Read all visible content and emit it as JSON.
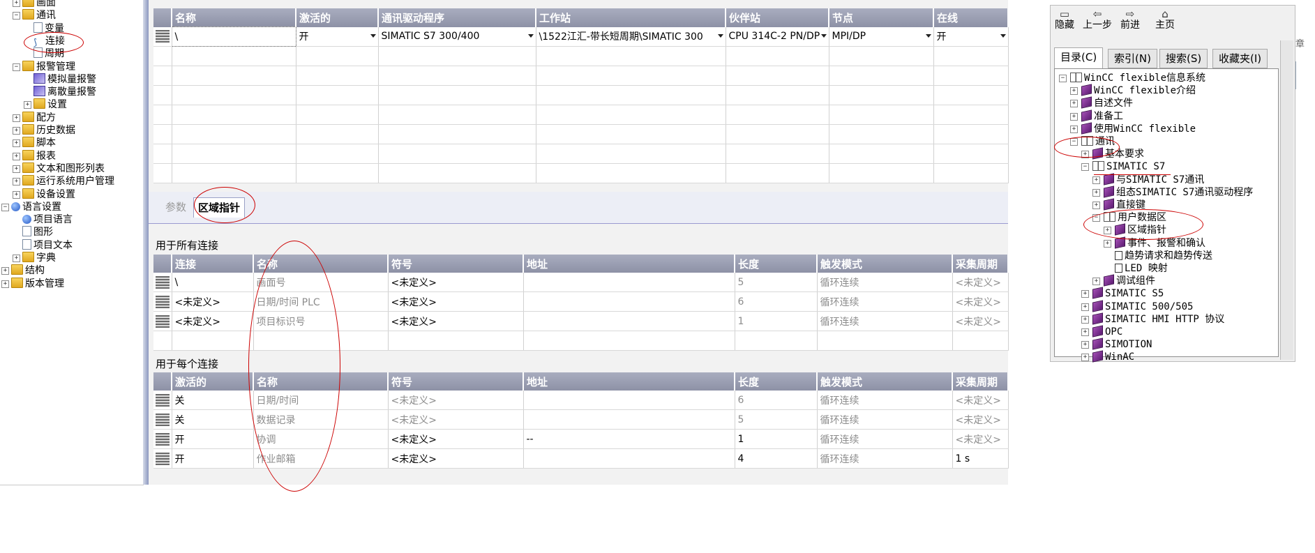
{
  "tree": {
    "items": [
      {
        "label": "画面",
        "level": 1,
        "icon": "folder",
        "toggle": "+"
      },
      {
        "label": "通讯",
        "level": 1,
        "icon": "folder",
        "toggle": "-"
      },
      {
        "label": "变量",
        "level": 2,
        "icon": "doc"
      },
      {
        "label": "连接",
        "level": 2,
        "icon": "conn"
      },
      {
        "label": "周期",
        "level": 2,
        "icon": "doc"
      },
      {
        "label": "报警管理",
        "level": 1,
        "icon": "folder",
        "toggle": "-"
      },
      {
        "label": "模拟量报警",
        "level": 2,
        "icon": "alarm"
      },
      {
        "label": "离散量报警",
        "level": 2,
        "icon": "alarm"
      },
      {
        "label": "设置",
        "level": 2,
        "icon": "folder",
        "toggle": "+"
      },
      {
        "label": "配方",
        "level": 1,
        "icon": "folder",
        "toggle": "+"
      },
      {
        "label": "历史数据",
        "level": 1,
        "icon": "folder",
        "toggle": "+"
      },
      {
        "label": "脚本",
        "level": 1,
        "icon": "folder",
        "toggle": "+"
      },
      {
        "label": "报表",
        "level": 1,
        "icon": "folder",
        "toggle": "+"
      },
      {
        "label": "文本和图形列表",
        "level": 1,
        "icon": "folder",
        "toggle": "+"
      },
      {
        "label": "运行系统用户管理",
        "level": 1,
        "icon": "folder",
        "toggle": "+"
      },
      {
        "label": "设备设置",
        "level": 1,
        "icon": "folder",
        "toggle": "+"
      },
      {
        "label": "语言设置",
        "level": 0,
        "icon": "globe",
        "toggle": "-"
      },
      {
        "label": "项目语言",
        "level": 1,
        "icon": "globe"
      },
      {
        "label": "图形",
        "level": 1,
        "icon": "doc"
      },
      {
        "label": "项目文本",
        "level": 1,
        "icon": "doc"
      },
      {
        "label": "字典",
        "level": 1,
        "icon": "folder",
        "toggle": "+"
      },
      {
        "label": "结构",
        "level": 0,
        "icon": "folder",
        "toggle": "+"
      },
      {
        "label": "版本管理",
        "level": 0,
        "icon": "folder",
        "toggle": "+"
      }
    ]
  },
  "connections": {
    "headers": [
      "名称",
      "激活的",
      "通讯驱动程序",
      "工作站",
      "伙伴站",
      "节点",
      "在线"
    ],
    "row": {
      "name": "\\",
      "active": "开",
      "driver": "SIMATIC S7 300/400",
      "station": "\\1522江汇-带长短周期\\SIMATIC 300",
      "partner": "CPU 314C-2 PN/DP",
      "node": "MPI/DP",
      "online": "开"
    }
  },
  "tabs": {
    "params": "参数",
    "area_pointer": "区域指针"
  },
  "all_connections": {
    "title": "用于所有连接",
    "headers": [
      "连接",
      "名称",
      "符号",
      "地址",
      "长度",
      "触发模式",
      "采集周期"
    ],
    "rows": [
      {
        "c1": "\\",
        "c2": "画面号",
        "c3": "<未定义>",
        "c4": "",
        "c5": "5",
        "c6": "循环连续",
        "c7": "<未定义>"
      },
      {
        "c1": "<未定义>",
        "c2": "日期/时间 PLC",
        "c3": "<未定义>",
        "c4": "",
        "c5": "6",
        "c6": "循环连续",
        "c7": "<未定义>"
      },
      {
        "c1": "<未定义>",
        "c2": "项目标识号",
        "c3": "<未定义>",
        "c4": "",
        "c5": "1",
        "c6": "循环连续",
        "c7": "<未定义>"
      }
    ]
  },
  "each_connection": {
    "title": "用于每个连接",
    "headers": [
      "激活的",
      "名称",
      "符号",
      "地址",
      "长度",
      "触发模式",
      "采集周期"
    ],
    "rows": [
      {
        "c1": "关",
        "c2": "日期/时间",
        "c3": "<未定义>",
        "c4": "",
        "c5": "6",
        "c6": "循环连续",
        "c7": "<未定义>"
      },
      {
        "c1": "关",
        "c2": "数据记录",
        "c3": "<未定义>",
        "c4": "",
        "c5": "5",
        "c6": "循环连续",
        "c7": "<未定义>"
      },
      {
        "c1": "开",
        "c2": "协调",
        "c3": "<未定义>",
        "c4": "--",
        "c5": "1",
        "c6": "循环连续",
        "c7": "<未定义>"
      },
      {
        "c1": "开",
        "c2": "作业邮箱",
        "c3": "<未定义>",
        "c4": "",
        "c5": "4",
        "c6": "循环连续",
        "c7": "1 s"
      }
    ]
  },
  "help": {
    "toolbar": [
      "隐藏",
      "上一步",
      "前进",
      "主页"
    ],
    "tabs": [
      "目录(C)",
      "索引(N)",
      "搜索(S)",
      "收藏夹(I)"
    ],
    "side_label": "章",
    "items": [
      {
        "label": "WinCC flexible信息系统",
        "level": 0,
        "type": "open",
        "toggle": "-"
      },
      {
        "label": "WinCC flexible介绍",
        "level": 1,
        "type": "book",
        "toggle": "+"
      },
      {
        "label": "自述文件",
        "level": 1,
        "type": "book",
        "toggle": "+"
      },
      {
        "label": "准备工",
        "level": 1,
        "type": "book",
        "toggle": "+"
      },
      {
        "label": "使用WinCC flexible",
        "level": 1,
        "type": "book",
        "toggle": "+"
      },
      {
        "label": "通讯",
        "level": 1,
        "type": "open",
        "toggle": "-"
      },
      {
        "label": "基本要求",
        "level": 2,
        "type": "book",
        "toggle": "+"
      },
      {
        "label": "SIMATIC S7",
        "level": 2,
        "type": "open",
        "toggle": "-"
      },
      {
        "label": "与SIMATIC S7通讯",
        "level": 3,
        "type": "book",
        "toggle": "+"
      },
      {
        "label": "组态SIMATIC S7通讯驱动程序",
        "level": 3,
        "type": "book",
        "toggle": "+"
      },
      {
        "label": "直接键",
        "level": 3,
        "type": "book",
        "toggle": "+"
      },
      {
        "label": "用户数据区",
        "level": 3,
        "type": "open",
        "toggle": "-"
      },
      {
        "label": "区域指针",
        "level": 4,
        "type": "book",
        "toggle": "+"
      },
      {
        "label": "事件、报警和确认",
        "level": 4,
        "type": "book",
        "toggle": "+"
      },
      {
        "label": "趋势请求和趋势传送",
        "level": 4,
        "type": "page"
      },
      {
        "label": "LED 映射",
        "level": 4,
        "type": "page"
      },
      {
        "label": "调试组件",
        "level": 3,
        "type": "book",
        "toggle": "+"
      },
      {
        "label": "SIMATIC S5",
        "level": 2,
        "type": "book",
        "toggle": "+"
      },
      {
        "label": "SIMATIC 500/505",
        "level": 2,
        "type": "book",
        "toggle": "+"
      },
      {
        "label": "SIMATIC HMI HTTP 协议",
        "level": 2,
        "type": "book",
        "toggle": "+"
      },
      {
        "label": "OPC",
        "level": 2,
        "type": "book",
        "toggle": "+"
      },
      {
        "label": "SIMOTION",
        "level": 2,
        "type": "book",
        "toggle": "+"
      },
      {
        "label": "WinAC",
        "level": 2,
        "type": "book",
        "toggle": "+"
      }
    ]
  },
  "colors": {
    "header": "#9a9eb3",
    "annotation": "#cc0000",
    "tab_border": "#9a9ad0"
  }
}
